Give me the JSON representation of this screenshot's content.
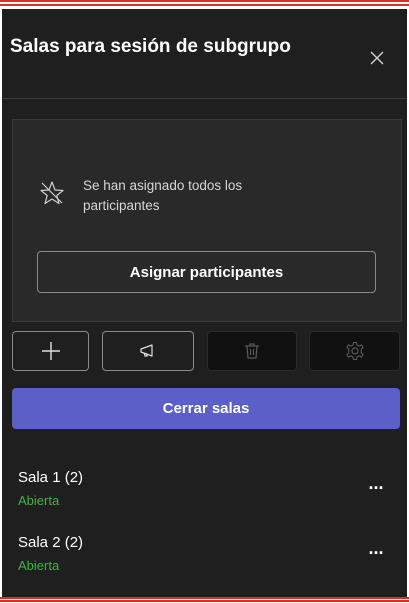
{
  "panel": {
    "title": "Salas para sesión de subgrupo",
    "close_icon": "close-icon"
  },
  "assign": {
    "icon": "star-outline-icon",
    "message": "Se han asignado todos los participantes",
    "button_label": "Asignar participantes"
  },
  "toolbar": {
    "add_icon": "plus-icon",
    "announce_icon": "megaphone-icon",
    "delete_icon": "trash-icon",
    "settings_icon": "gear-icon"
  },
  "close_rooms_label": "Cerrar salas",
  "rooms": [
    {
      "name": "Sala 1",
      "count": "(2)",
      "status": "Abierta",
      "more": "..."
    },
    {
      "name": "Sala 2",
      "count": "(2)",
      "status": "Abierta",
      "more": "..."
    }
  ],
  "colors": {
    "accent": "#5b5fc7",
    "status_open": "#3fb33f",
    "background": "#1f1f1f"
  }
}
